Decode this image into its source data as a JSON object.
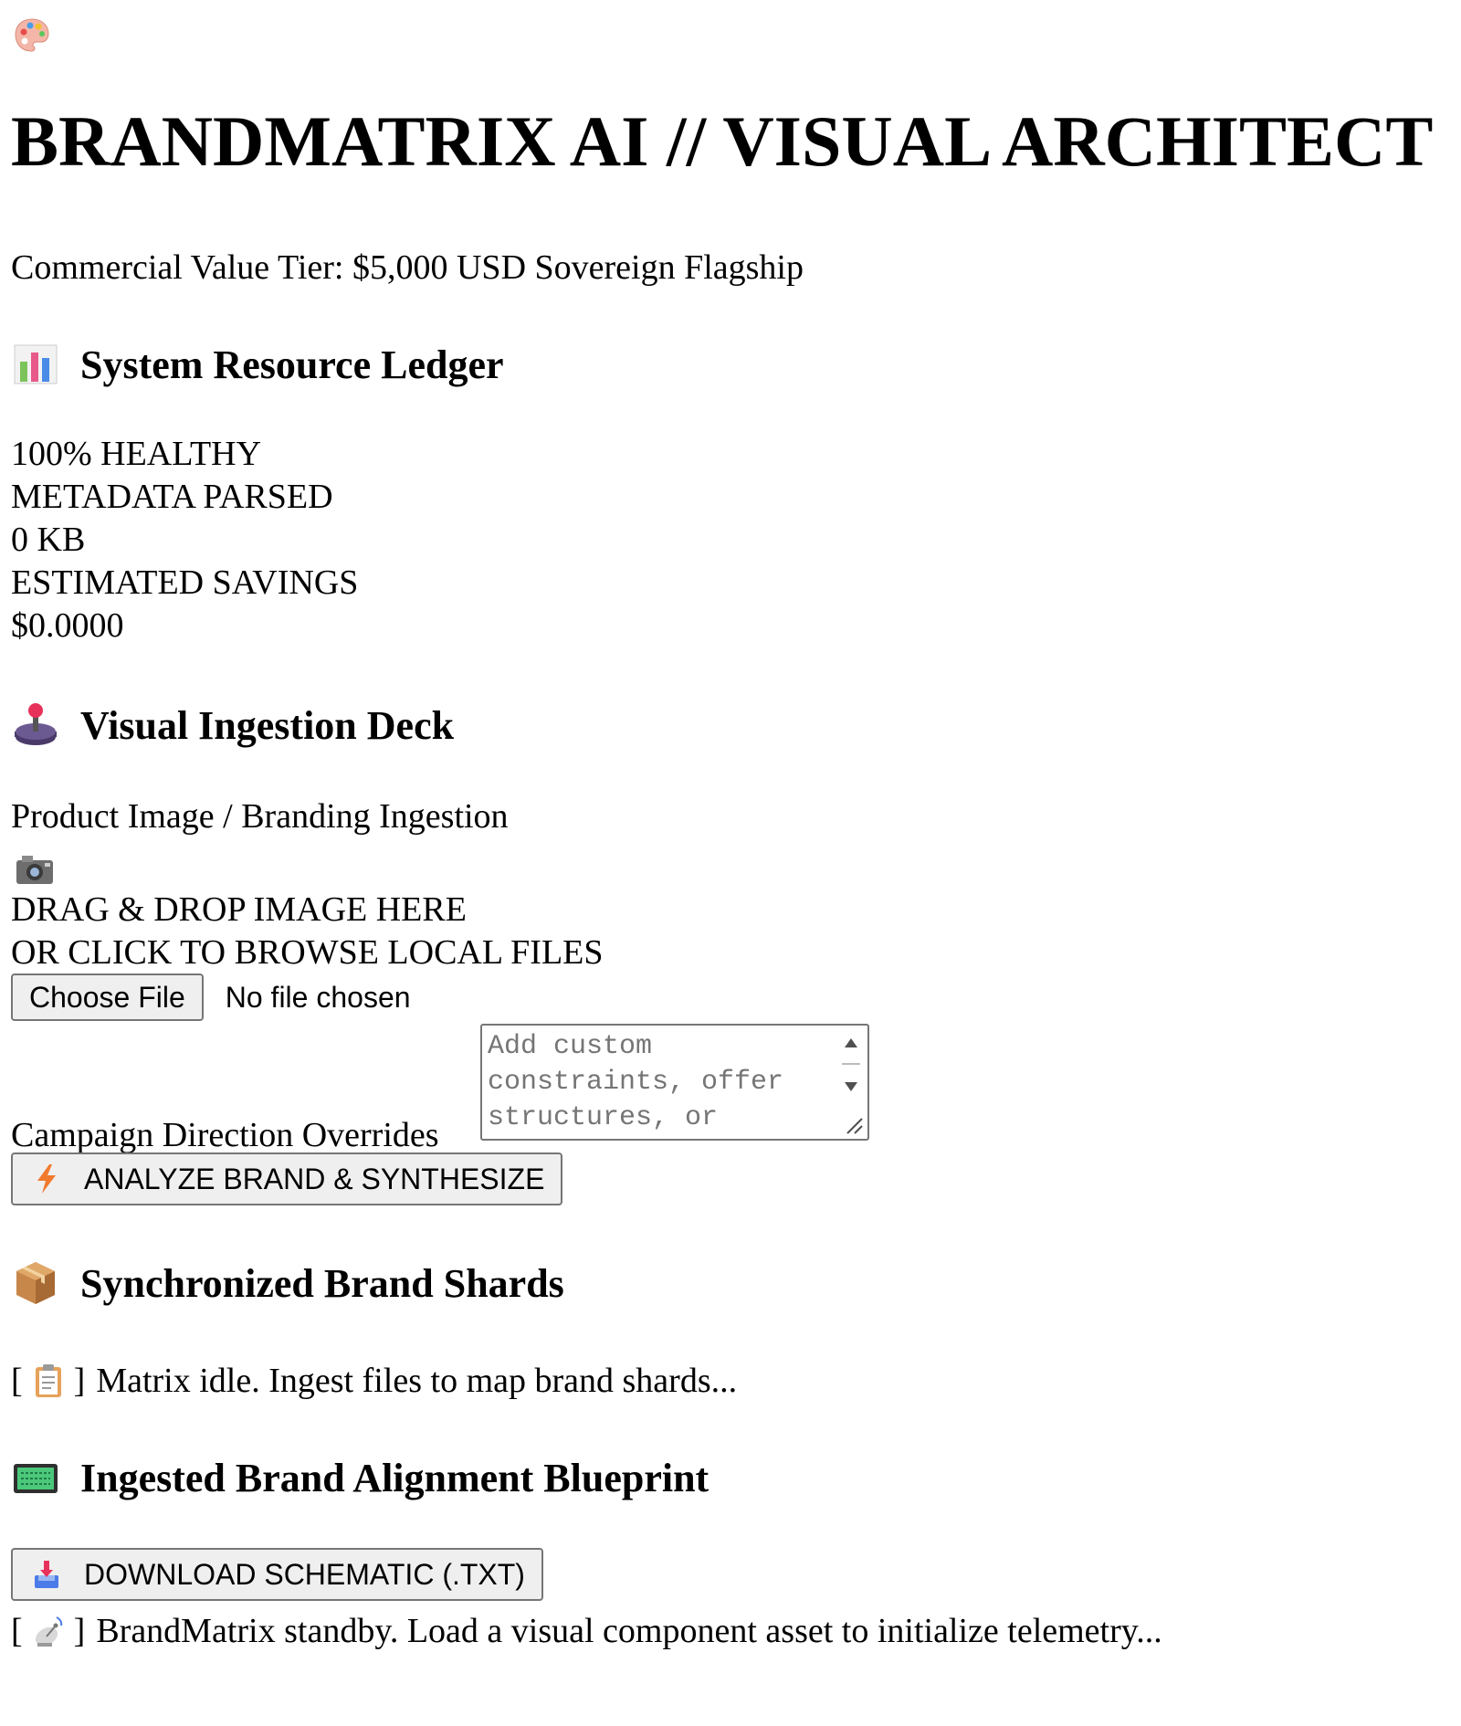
{
  "header": {
    "favicon": "palette-icon",
    "title": "BRANDMATRIX AI // VISUAL ARCHITECT",
    "subtitle": "Commercial Value Tier: $5,000 USD Sovereign Flagship"
  },
  "ledger": {
    "heading": "System Resource Ledger",
    "icon": "bar-chart-icon",
    "health": "100% HEALTHY",
    "metadata_label": "METADATA PARSED",
    "metadata_value": "0 KB",
    "savings_label": "ESTIMATED SAVINGS",
    "savings_value": "$0.0000"
  },
  "ingestion": {
    "heading": "Visual Ingestion Deck",
    "icon": "joystick-icon",
    "field_label": "Product Image / Branding Ingestion",
    "camera_icon": "camera-icon",
    "drop_line1": "DRAG & DROP IMAGE HERE",
    "drop_line2": "OR CLICK TO BROWSE LOCAL FILES",
    "choose_file_label": "Choose File",
    "file_status": "No file chosen",
    "overrides_label": "Campaign Direction Overrides",
    "overrides_placeholder": "Add custom constraints, offer structures, or",
    "analyze_label": "ANALYZE BRAND & SYNTHESIZE",
    "analyze_icon": "lightning-icon"
  },
  "shards": {
    "heading": "Synchronized Brand Shards",
    "icon": "package-icon",
    "bracket_open": "[",
    "bracket_close": "]",
    "status_icon": "clipboard-icon",
    "status_text": "Matrix idle. Ingest files to map brand shards..."
  },
  "blueprint": {
    "heading": "Ingested Brand Alignment Blueprint",
    "icon": "terminal-icon",
    "download_label": "DOWNLOAD SCHEMATIC (.TXT)",
    "download_icon": "inbox-tray-icon",
    "bracket_open": "[",
    "bracket_close": "]",
    "status_icon": "satellite-icon",
    "status_text": "BrandMatrix standby. Load a visual component asset to initialize telemetry..."
  }
}
